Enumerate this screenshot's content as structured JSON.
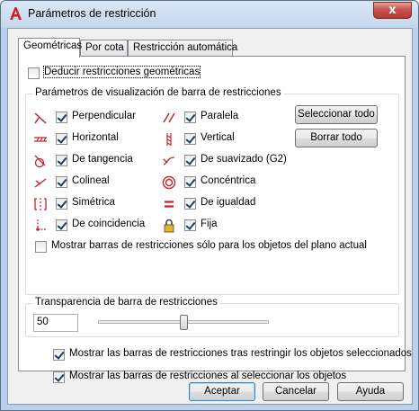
{
  "window": {
    "title": "Parámetros de restricción",
    "close_glyph": "x"
  },
  "tabs": [
    {
      "label": "Geométricas",
      "active": true
    },
    {
      "label": "Por cota",
      "active": false
    },
    {
      "label": "Restricción automática",
      "active": false
    }
  ],
  "infer": {
    "label": "Deducir restricciones geométricas",
    "checked": false
  },
  "display_group": {
    "title": "Parámetros de visualización de barra de restricciones",
    "left": [
      {
        "label": "Perpendicular",
        "icon": "perpendicular-icon",
        "checked": true
      },
      {
        "label": "Horizontal",
        "icon": "horizontal-icon",
        "checked": true
      },
      {
        "label": "De tangencia",
        "icon": "tangent-icon",
        "checked": true
      },
      {
        "label": "Colineal",
        "icon": "collinear-icon",
        "checked": true
      },
      {
        "label": "Simétrica",
        "icon": "symmetric-icon",
        "checked": true
      },
      {
        "label": "De coincidencia",
        "icon": "coincident-icon",
        "checked": true
      }
    ],
    "right": [
      {
        "label": "Paralela",
        "icon": "parallel-icon",
        "checked": true
      },
      {
        "label": "Vertical",
        "icon": "vertical-icon",
        "checked": true
      },
      {
        "label": "De suavizado (G2)",
        "icon": "smooth-icon",
        "checked": true
      },
      {
        "label": "Concéntrica",
        "icon": "concentric-icon",
        "checked": true
      },
      {
        "label": "De igualdad",
        "icon": "equal-icon",
        "checked": true
      },
      {
        "label": "Fija",
        "icon": "lock-icon",
        "checked": true
      }
    ],
    "select_all": "Seleccionar todo",
    "clear_all": "Borrar todo",
    "current_plane": {
      "label": "Mostrar barras de restricciones sólo para los objetos del plano actual",
      "checked": false
    }
  },
  "transparency": {
    "title": "Transparencia de barra de restricciones",
    "value": "50",
    "slider_percent": 50
  },
  "show_after_constrain": {
    "label": "Mostrar las barras de restricciones tras restringir los objetos seleccionados",
    "checked": true
  },
  "show_on_select": {
    "label": "Mostrar las barras de restricciones al seleccionar los objetos",
    "checked": true
  },
  "buttons": {
    "ok": "Aceptar",
    "cancel": "Cancelar",
    "help": "Ayuda"
  },
  "colors": {
    "accent": "#3c7fb1",
    "icon_red": "#c8232c",
    "titlebar": "#c3d6ec"
  }
}
